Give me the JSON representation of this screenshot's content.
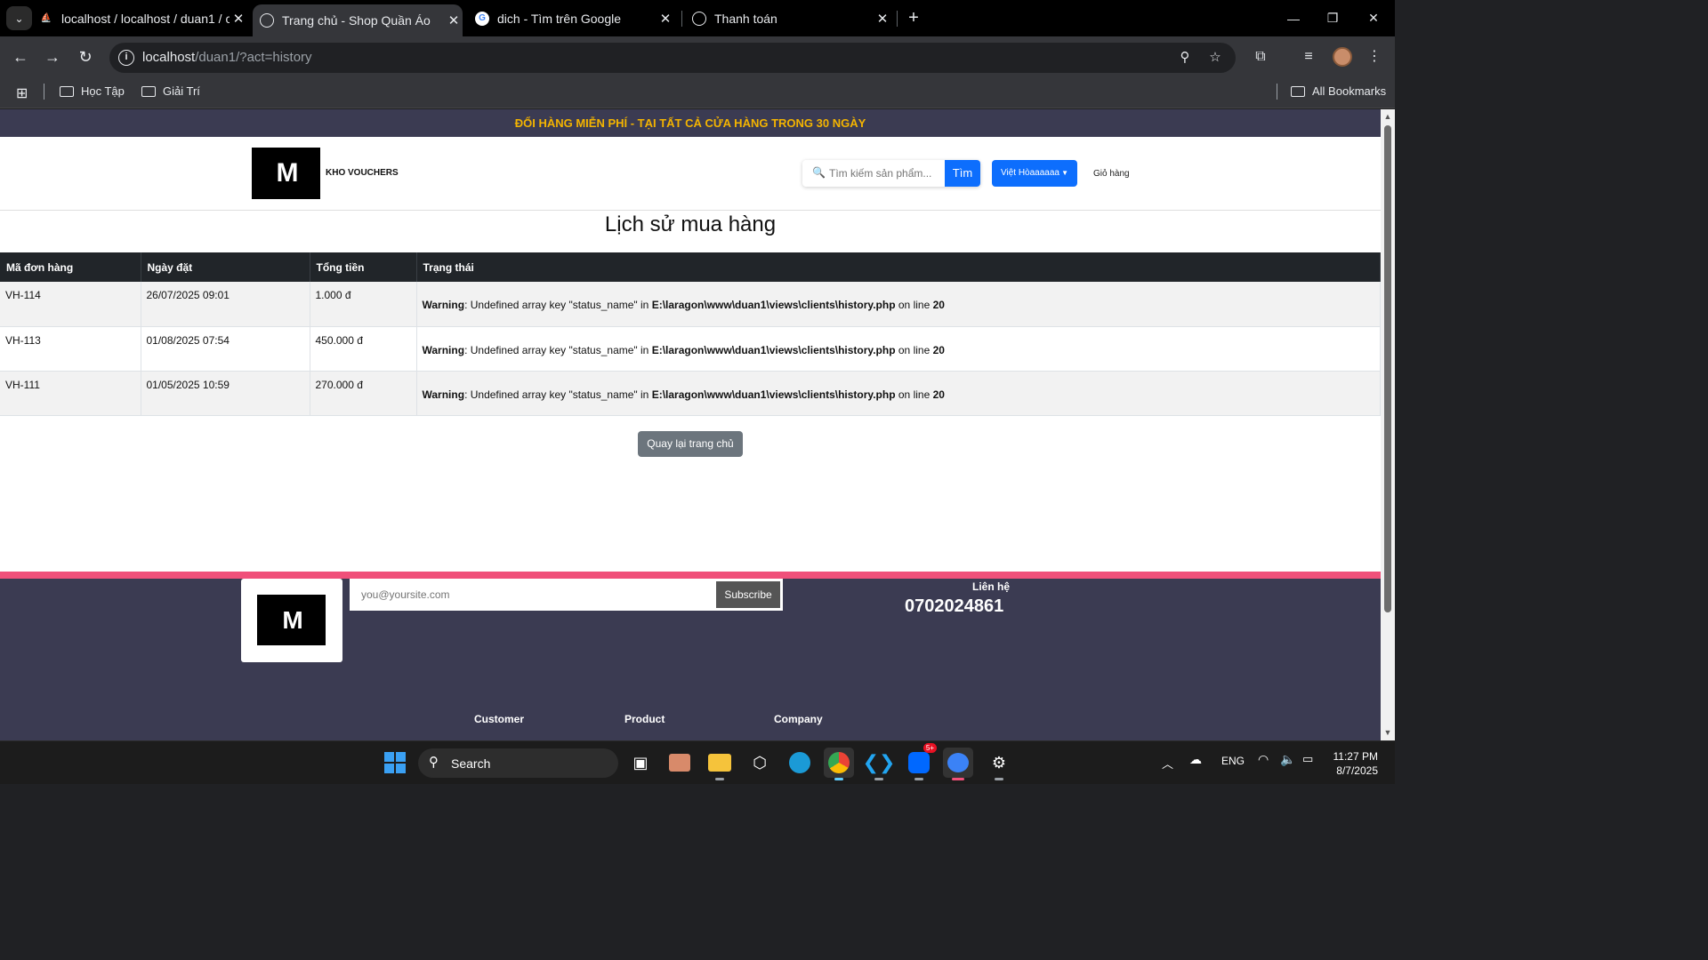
{
  "browser": {
    "tabs": [
      {
        "title": "localhost / localhost / duan1 / c",
        "active": false
      },
      {
        "title": "Trang chủ - Shop Quần Áo",
        "active": true
      },
      {
        "title": "dich - Tìm trên Google",
        "active": false
      },
      {
        "title": "Thanh toán",
        "active": false
      }
    ],
    "url_host": "localhost",
    "url_path": "/duan1/?act=history",
    "bookmarks": [
      "Học Tập",
      "Giải Trí"
    ],
    "all_bookmarks": "All Bookmarks"
  },
  "page": {
    "promo": "ĐỔI HÀNG MIỄN PHÍ - TẠI TẤT CẢ CỬA HÀNG TRONG 30 NGÀY",
    "logo_text": "M",
    "vouchers_link": "KHO VOUCHERS",
    "search_placeholder": "Tìm kiếm sản phẩm...",
    "search_button": "Tìm",
    "user_menu": "Việt Hòaaaaaa",
    "cart_link": "Giỏ hàng",
    "title": "Lịch sử mua hàng",
    "table": {
      "headers": [
        "Mã đơn hàng",
        "Ngày đặt",
        "Tổng tiền",
        "Trạng thái"
      ],
      "rows": [
        {
          "id": "VH-114",
          "date": "26/07/2025 09:01",
          "total": "1.000 đ"
        },
        {
          "id": "VH-113",
          "date": "01/08/2025 07:54",
          "total": "450.000 đ"
        },
        {
          "id": "VH-111",
          "date": "01/05/2025 10:59",
          "total": "270.000 đ"
        }
      ],
      "warning": {
        "label": "Warning",
        "message": ": Undefined array key \"status_name\" in ",
        "file": "E:\\laragon\\www\\duan1\\views\\clients\\history.php",
        "on_line": " on line ",
        "line": "20"
      }
    },
    "back_button": "Quay lại trang chủ",
    "footer": {
      "email_placeholder": "you@yoursite.com",
      "subscribe": "Subscribe",
      "contact_label": "Liên hệ",
      "phone": "0702024861",
      "columns": [
        "Customer",
        "Product",
        "Company"
      ]
    }
  },
  "taskbar": {
    "search": "Search",
    "lang": "ENG",
    "time": "11:27 PM",
    "date": "8/7/2025",
    "zalo_badge": "5+"
  }
}
